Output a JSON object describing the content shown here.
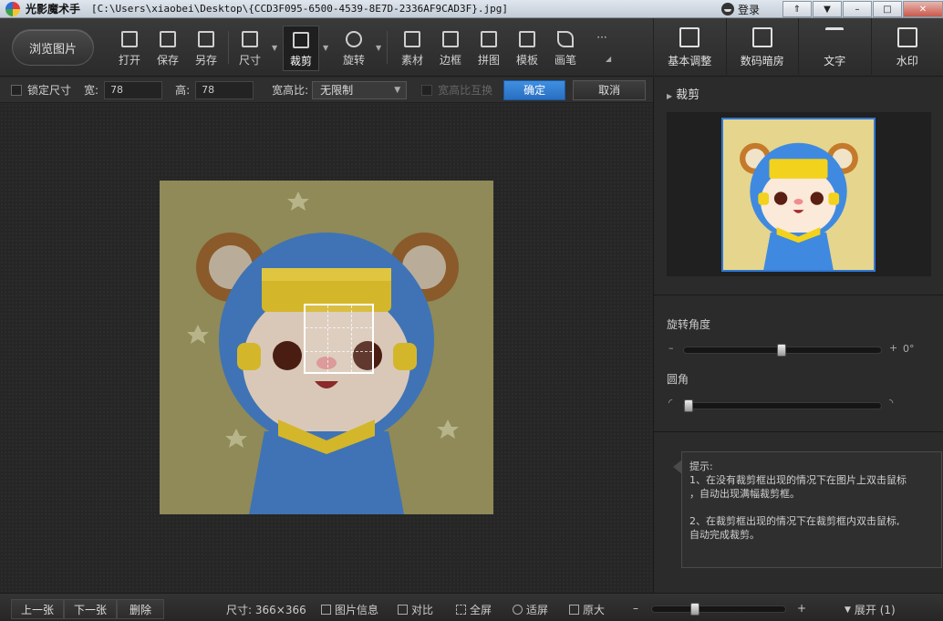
{
  "window": {
    "app_name": "光影魔术手",
    "file_path": "[C:\\Users\\xiaobei\\Desktop\\{CCD3F095-6500-4539-8E7D-2336AF9CAD3F}.jpg]",
    "login": "登录",
    "controls": {
      "up": "⇑",
      "menu": "▼",
      "minimize": "–",
      "maximize": "□",
      "close": "✕"
    }
  },
  "toolbar": {
    "browse": "浏览图片",
    "tools": [
      "打开",
      "保存",
      "另存",
      "尺寸",
      "裁剪",
      "旋转",
      "素材",
      "边框",
      "拼图",
      "模板",
      "画笔"
    ],
    "more": "···"
  },
  "right_toolbar": {
    "tools": [
      "基本调整",
      "数码暗房",
      "文字",
      "水印"
    ]
  },
  "crop_options": {
    "lock_size": "锁定尺寸",
    "width_label": "宽:",
    "width_value": "78",
    "height_label": "高:",
    "height_value": "78",
    "ratio_label": "宽高比:",
    "ratio_value": "无限制",
    "swap_label": "宽高比互换",
    "confirm": "确定",
    "cancel": "取消"
  },
  "panel": {
    "title": "裁剪",
    "rotate_label": "旋转角度",
    "rotate_value": "0°",
    "rotate_minus": "–",
    "rotate_plus": "+",
    "round_label": "圆角",
    "hint_title": "提示:",
    "hint_1": "1、在没有裁剪框出现的情况下在图片上双击鼠标\n，自动出现满幅裁剪框。",
    "hint_2": "2、在裁剪框出现的情况下在裁剪框内双击鼠标,\n自动完成裁剪。"
  },
  "status": {
    "prev": "上一张",
    "next": "下一张",
    "delete": "删除",
    "size_label": "尺寸: 366×366",
    "info": "图片信息",
    "compare": "对比",
    "fullscreen": "全屏",
    "fit": "适屏",
    "original": "原大",
    "zoom_minus": "–",
    "zoom_plus": "+",
    "expand": "展开 (1)"
  },
  "colors": {
    "accent": "#2f78d6",
    "image_bg": "#8f8a58",
    "thumb_bg": "#e6d58d"
  }
}
